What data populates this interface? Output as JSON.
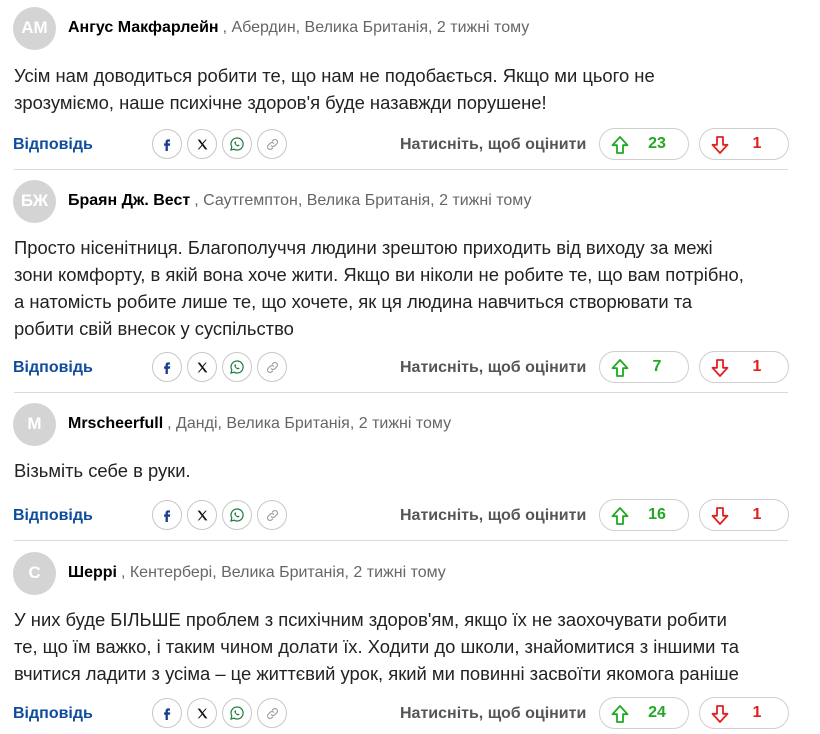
{
  "labels": {
    "reply": "Відповідь",
    "rate": "Натисніть, щоб оцінити"
  },
  "colors": {
    "upvote": "#22a822",
    "downvote": "#e02020",
    "reply_link": "#0f4c9c",
    "avatar_bg": "#d4d4d4"
  },
  "icons": [
    "facebook-icon",
    "x-icon",
    "whatsapp-icon",
    "link-icon",
    "thumb-arrow-up-icon",
    "thumb-arrow-down-icon"
  ],
  "comments": [
    {
      "initials": "AM",
      "name": "Ангус Макфарлейн",
      "meta": ", Абердин, Велика Британія, 2 тижні тому",
      "text_lines": [
        "Усім нам доводиться робити те, що нам не подобається. Якщо ми цього не",
        "зрозуміємо, наше психічне здоров'я буде назавжди порушене!"
      ],
      "upvotes": "23",
      "downvotes": "1"
    },
    {
      "initials": "БЖ",
      "name": "Браян Дж. Вест",
      "meta": ", Саутгемптон, Велика Британія, 2 тижні тому",
      "text_lines": [
        "Просто нісенітниця. Благополуччя людини зрештою приходить від виходу за межі",
        "зони комфорту, в якій вона хоче жити. Якщо ви ніколи не робите те, що вам потрібно,",
        "а натомість робите лише те, що хочете, як ця людина навчиться створювати та",
        "робити свій внесок у суспільство"
      ],
      "upvotes": "7",
      "downvotes": "1"
    },
    {
      "initials": "M",
      "name": "Mrscheerfull",
      "meta": ", Данді, Велика Британія, 2 тижні тому",
      "text_lines": [
        "Візьміть себе в руки."
      ],
      "upvotes": "16",
      "downvotes": "1"
    },
    {
      "initials": "С",
      "name": "Шеррі",
      "meta": ", Кентербері, Велика Британія, 2 тижні тому",
      "text_lines": [
        "У них буде БІЛЬШЕ проблем з психічним здоров'ям, якщо їх не заохочувати робити",
        "те, що їм важко, і таким чином долати їх. Ходити до школи, знайомитися з іншими та",
        "вчитися ладити з усіма – це життєвий урок, який ми повинні засвоїти якомога раніше"
      ],
      "upvotes": "24",
      "downvotes": "1"
    }
  ]
}
